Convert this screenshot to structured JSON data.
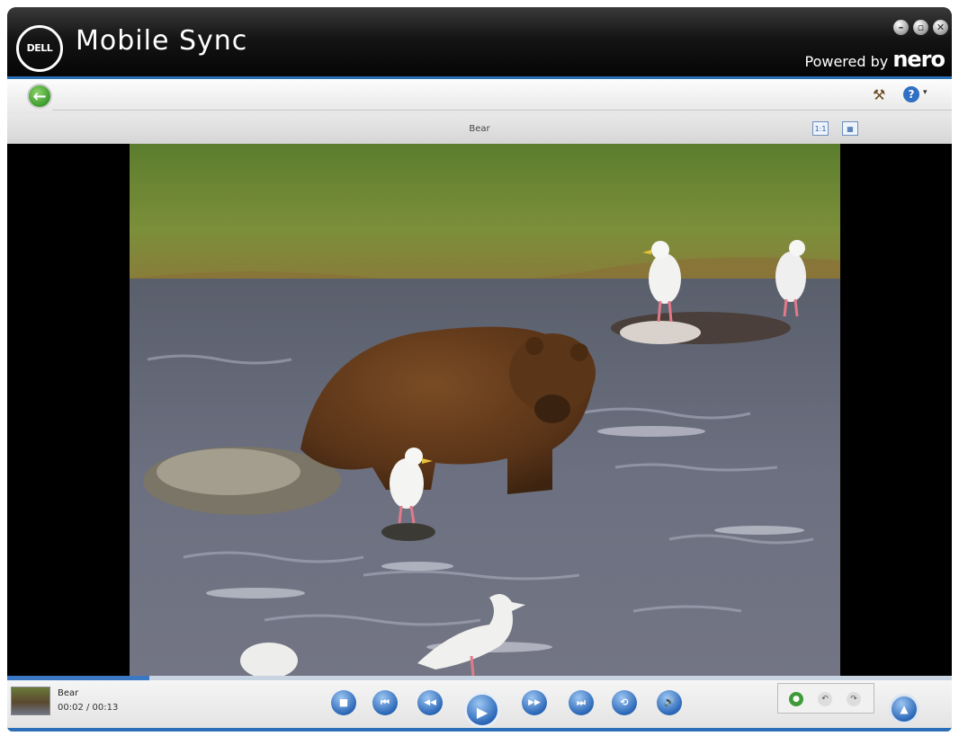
{
  "window": {
    "logo_text": "DELL",
    "title": "Mobile Sync",
    "powered_prefix": "Powered by",
    "powered_brand": "nero"
  },
  "window_controls": {
    "minimize": "–",
    "restore": "▫",
    "close": "✕"
  },
  "navbar": {
    "back_glyph": "←",
    "tool_glyph": "⚒",
    "help_glyph": "?",
    "help_arrow": "▾"
  },
  "media": {
    "title": "Bear",
    "view_actual_size_label": "1:1",
    "view_fit_label": "▦"
  },
  "player": {
    "clip_name": "Bear",
    "time": "00:02 / 00:13",
    "progress_fraction": 0.15,
    "buttons": {
      "stop": "■",
      "prev": "⏮",
      "rewind": "◀◀",
      "play": "▶",
      "forward": "▶▶",
      "next": "⏭",
      "repeat": "⟲",
      "volume": "🔊"
    },
    "panel": {
      "globe": "●",
      "rotate_left": "↶",
      "rotate_right": "↷"
    },
    "expand": "▲"
  },
  "colors": {
    "accent": "#2a6fb5",
    "button_blue": "#2c68b8"
  }
}
